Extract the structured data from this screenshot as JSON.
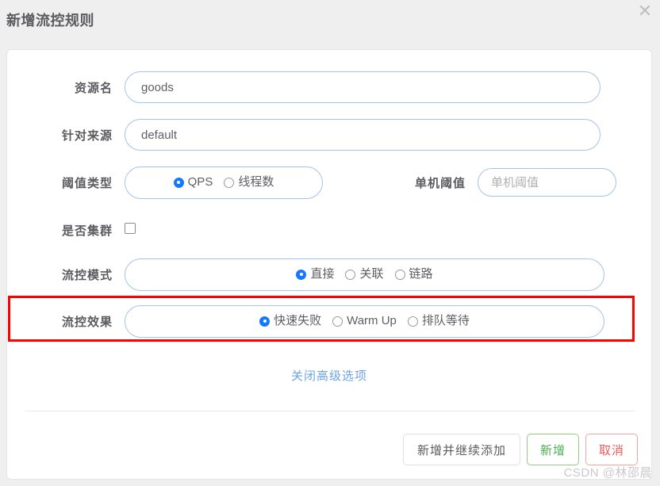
{
  "dialog": {
    "title": "新增流控规则",
    "close_icon": "✕"
  },
  "form": {
    "resource": {
      "label": "资源名",
      "value": "goods",
      "placeholder": "资源名"
    },
    "origin": {
      "label": "针对来源",
      "value": "default",
      "placeholder": "针对来源"
    },
    "threshold_type": {
      "label": "阈值类型",
      "options": [
        {
          "label": "QPS",
          "checked": true
        },
        {
          "label": "线程数",
          "checked": false
        }
      ]
    },
    "single_threshold": {
      "label": "单机阈值",
      "value": "",
      "placeholder": "单机阈值"
    },
    "is_cluster": {
      "label": "是否集群",
      "checked": false
    },
    "flow_mode": {
      "label": "流控模式",
      "options": [
        {
          "label": "直接",
          "checked": true
        },
        {
          "label": "关联",
          "checked": false
        },
        {
          "label": "链路",
          "checked": false
        }
      ]
    },
    "flow_effect": {
      "label": "流控效果",
      "options": [
        {
          "label": "快速失败",
          "checked": true
        },
        {
          "label": "Warm Up",
          "checked": false
        },
        {
          "label": "排队等待",
          "checked": false
        }
      ]
    },
    "advanced_link": "关闭高级选项"
  },
  "footer": {
    "buttons": [
      {
        "label": "新增并继续添加",
        "style": "default"
      },
      {
        "label": "新增",
        "style": "success"
      },
      {
        "label": "取消",
        "style": "danger"
      }
    ]
  },
  "watermark": "CSDN @林邵晨",
  "colors": {
    "accent_blue": "#1677ff",
    "border_blue": "#a3c4e8",
    "link_blue": "#6ba4e8",
    "success_green": "#4caf50",
    "danger_red": "#f05a5a",
    "highlight_red": "#ff0000",
    "page_bg": "#efeff0"
  }
}
